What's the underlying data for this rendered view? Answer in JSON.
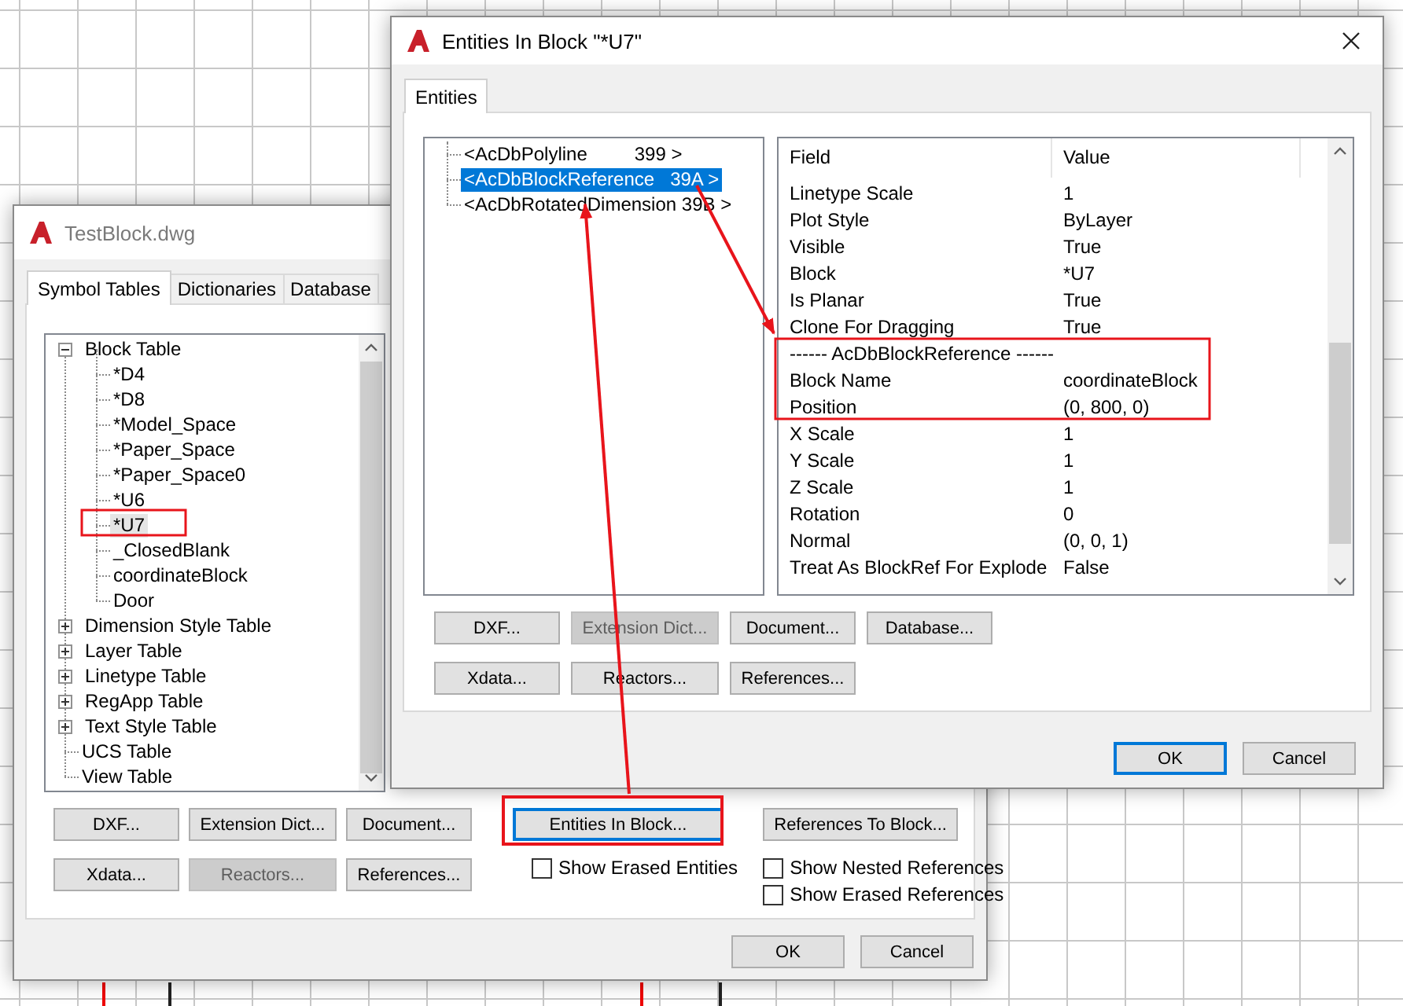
{
  "back_window": {
    "title": "TestBlock.dwg",
    "tabs": [
      {
        "label": "Symbol Tables",
        "selected": true
      },
      {
        "label": "Dictionaries",
        "selected": false
      },
      {
        "label": "Database",
        "selected": false
      }
    ],
    "tree": [
      {
        "label": "Block Table",
        "expanded": true,
        "selected": false,
        "children": [
          {
            "label": "*D4",
            "selected": false
          },
          {
            "label": "*D8",
            "selected": false
          },
          {
            "label": "*Model_Space",
            "selected": false
          },
          {
            "label": "*Paper_Space",
            "selected": false
          },
          {
            "label": "*Paper_Space0",
            "selected": false
          },
          {
            "label": "*U6",
            "selected": false
          },
          {
            "label": "*U7",
            "selected": true
          },
          {
            "label": "_ClosedBlank",
            "selected": false
          },
          {
            "label": "coordinateBlock",
            "selected": false
          },
          {
            "label": "Door",
            "selected": false
          }
        ]
      },
      {
        "label": "Dimension Style Table",
        "expanded": false,
        "selected": false
      },
      {
        "label": "Layer Table",
        "expanded": false,
        "selected": false
      },
      {
        "label": "Linetype Table",
        "expanded": false,
        "selected": false
      },
      {
        "label": "RegApp Table",
        "expanded": false,
        "selected": false
      },
      {
        "label": "Text Style Table",
        "expanded": false,
        "selected": false
      },
      {
        "label": "UCS Table",
        "selected": false
      },
      {
        "label": "View Table",
        "selected": false
      }
    ],
    "object_buttons": [
      {
        "label": "DXF...",
        "disabled": false
      },
      {
        "label": "Extension Dict...",
        "disabled": false
      },
      {
        "label": "Document...",
        "disabled": false
      },
      {
        "label": "Xdata...",
        "disabled": false
      },
      {
        "label": "Reactors...",
        "disabled": true
      },
      {
        "label": "References...",
        "disabled": false
      }
    ],
    "block_actions": [
      {
        "button": {
          "label": "Entities In Block...",
          "focused": true
        },
        "checkboxes": [
          {
            "label": "Show Erased Entities",
            "checked": false
          }
        ]
      },
      {
        "button": {
          "label": "References To Block...",
          "focused": false
        },
        "checkboxes": [
          {
            "label": "Show Nested References",
            "checked": false
          },
          {
            "label": "Show Erased References",
            "checked": false
          }
        ]
      }
    ],
    "dialog_buttons": [
      {
        "label": "OK",
        "focused": false
      },
      {
        "label": "Cancel",
        "focused": false
      }
    ]
  },
  "front_window": {
    "title": "Entities In Block \"*U7\"",
    "tabs": [
      {
        "label": "Entities",
        "selected": true
      }
    ],
    "tree": [
      {
        "label": "<AcDbPolyline         399 >",
        "selected": false
      },
      {
        "label": "<AcDbBlockReference   39A >",
        "selected": true
      },
      {
        "label": "<AcDbRotatedDimension 39B >",
        "selected": false
      }
    ],
    "table": {
      "columns": [
        "Field",
        "Value"
      ],
      "rows": [
        {
          "kind": "property",
          "field": "Linetype Scale",
          "value": "1"
        },
        {
          "kind": "property",
          "field": "Plot Style",
          "value": "ByLayer"
        },
        {
          "kind": "property",
          "field": "Visible",
          "value": "True"
        },
        {
          "kind": "property",
          "field": "Block",
          "value": "*U7"
        },
        {
          "kind": "property",
          "field": "Is Planar",
          "value": "True"
        },
        {
          "kind": "property",
          "field": "Clone For Dragging",
          "value": "True"
        },
        {
          "kind": "section",
          "field": "------ AcDbBlockReference ------"
        },
        {
          "kind": "property",
          "field": "Block Name",
          "value": "coordinateBlock"
        },
        {
          "kind": "property",
          "field": "Position",
          "value": "(0, 800, 0)"
        },
        {
          "kind": "property",
          "field": "X Scale",
          "value": "1"
        },
        {
          "kind": "property",
          "field": "Y Scale",
          "value": "1"
        },
        {
          "kind": "property",
          "field": "Z Scale",
          "value": "1"
        },
        {
          "kind": "property",
          "field": "Rotation",
          "value": "0"
        },
        {
          "kind": "property",
          "field": "Normal",
          "value": "(0, 0, 1)"
        },
        {
          "kind": "property",
          "field": "Treat As BlockRef For Explode",
          "value": "False"
        }
      ]
    },
    "object_buttons": [
      {
        "label": "DXF...",
        "disabled": false
      },
      {
        "label": "Extension Dict...",
        "disabled": true
      },
      {
        "label": "Document...",
        "disabled": false
      },
      {
        "label": "Database...",
        "disabled": false
      },
      {
        "label": "Xdata...",
        "disabled": false
      },
      {
        "label": "Reactors...",
        "disabled": false
      },
      {
        "label": "References...",
        "disabled": false
      }
    ],
    "dialog_buttons": [
      {
        "label": "OK",
        "focused": true
      },
      {
        "label": "Cancel",
        "focused": false
      }
    ]
  }
}
